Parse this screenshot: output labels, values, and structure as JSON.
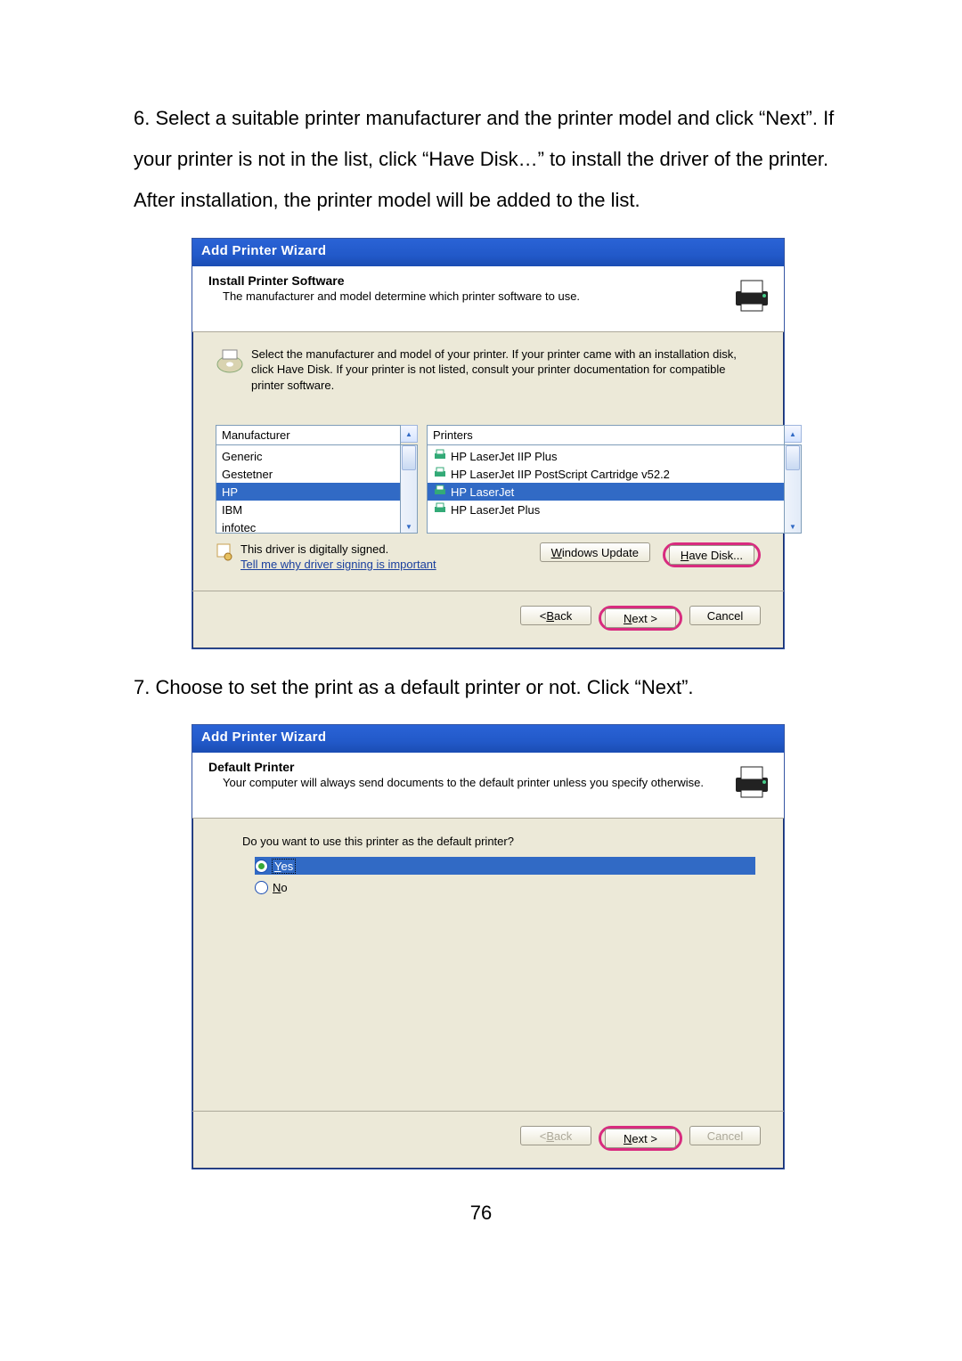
{
  "instructions": {
    "step6_num": "6.",
    "step6_text": "Select a suitable printer manufacturer and the printer model and click “Next”. If your printer is not in the list, click “Have Disk…” to install the driver of the printer. After installation, the printer model will be added to the list.",
    "step7_num": "7.",
    "step7_text": "Choose to set the print as a default printer or not. Click “Next”."
  },
  "dialog1": {
    "title": "Add Printer Wizard",
    "header": {
      "title": "Install Printer Software",
      "subtitle": "The manufacturer and model determine which printer software to use."
    },
    "instruction": "Select the manufacturer and model of your printer. If your printer came with an installation disk, click Have Disk. If your printer is not listed, consult your printer documentation for compatible printer software.",
    "columns": {
      "mfg": "Manufacturer",
      "prt": "Printers"
    },
    "manufacturers": [
      "Generic",
      "Gestetner",
      "HP",
      "IBM",
      "infotec"
    ],
    "mfg_selected_index": 2,
    "printers": [
      "HP LaserJet IIP Plus",
      "HP LaserJet IIP PostScript Cartridge v52.2",
      "HP LaserJet",
      "HP LaserJet Plus"
    ],
    "prt_selected_index": 2,
    "signed_text": "This driver is digitally signed.",
    "signed_link": "Tell me why driver signing is important",
    "buttons": {
      "win_update": {
        "pre": "",
        "mn": "W",
        "post": "indows Update"
      },
      "have_disk": {
        "pre": "",
        "mn": "H",
        "post": "ave Disk..."
      },
      "back": {
        "pre": "< ",
        "mn": "B",
        "post": "ack"
      },
      "next": {
        "pre": "",
        "mn": "N",
        "post": "ext >"
      },
      "cancel": "Cancel"
    }
  },
  "dialog2": {
    "title": "Add Printer Wizard",
    "header": {
      "title": "Default Printer",
      "subtitle": "Your computer will always send documents to the default printer unless you specify otherwise."
    },
    "question": "Do you want to use this printer as the default printer?",
    "options": {
      "yes": {
        "mn": "Y",
        "post": "es"
      },
      "no": {
        "mn": "N",
        "post": "o"
      }
    },
    "selected": "yes",
    "buttons": {
      "back": {
        "pre": "< ",
        "mn": "B",
        "post": "ack"
      },
      "next": {
        "pre": "",
        "mn": "N",
        "post": "ext >"
      },
      "cancel": "Cancel"
    }
  },
  "page_number": "76"
}
